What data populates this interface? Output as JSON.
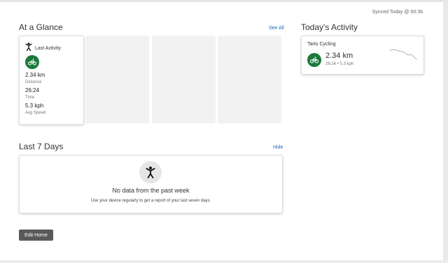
{
  "header": {
    "sync_status": "Synced Today @ 00:36"
  },
  "glance": {
    "title": "At a Glance",
    "see_all": "See All",
    "last_activity": {
      "title": "Last Activity",
      "distance_value": "2.34 km",
      "distance_label": "Distance",
      "time_value": "26:24",
      "time_label": "Time",
      "speed_value": "5.3 kph",
      "speed_label": "Avg Speed",
      "icon": "cycling-icon"
    }
  },
  "today": {
    "title": "Today's Activity",
    "activity_name": "Tartu Cycling",
    "distance": "2.34 km",
    "details": "26:24 • 5.3 kph",
    "icon": "cycling-icon"
  },
  "last7": {
    "title": "Last 7 Days",
    "hide": "Hide",
    "empty_title": "No data from the past week",
    "empty_sub": "Use your device regularly to get a report of your last seven days."
  },
  "footer": {
    "edit_home": "Edit Home"
  },
  "colors": {
    "accent_green": "#1a7a3a",
    "link_blue": "#1a66b3",
    "button_gray": "#595959"
  }
}
